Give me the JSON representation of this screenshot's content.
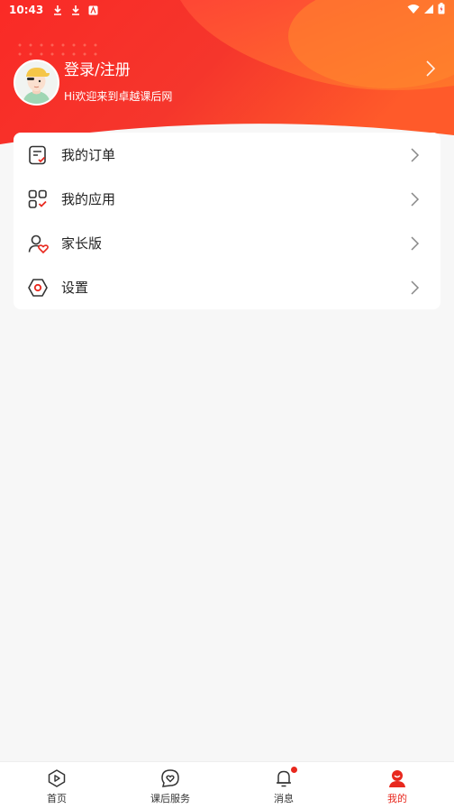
{
  "status_bar": {
    "time": "10:43",
    "icons": [
      "download-icon",
      "download-icon",
      "a-icon",
      "wifi-icon",
      "signal-icon",
      "battery-icon"
    ]
  },
  "profile": {
    "title": "登录/注册",
    "subtitle": "Hi欢迎来到卓越课后网"
  },
  "menu": {
    "items": [
      {
        "label": "我的订单",
        "icon": "order-list-icon"
      },
      {
        "label": "我的应用",
        "icon": "apps-grid-icon"
      },
      {
        "label": "家长版",
        "icon": "parent-icon"
      },
      {
        "label": "设置",
        "icon": "settings-icon"
      }
    ]
  },
  "bottom_nav": {
    "items": [
      {
        "label": "首页",
        "icon": "home-play-icon",
        "active": false
      },
      {
        "label": "课后服务",
        "icon": "heart-chat-icon",
        "active": false
      },
      {
        "label": "消息",
        "icon": "bell-icon",
        "active": false,
        "badge": true
      },
      {
        "label": "我的",
        "icon": "profile-icon",
        "active": true
      }
    ]
  },
  "colors": {
    "brand_red": "#e8281e",
    "hero_orange": "#ff6a2c",
    "background": "#f7f7f7"
  }
}
